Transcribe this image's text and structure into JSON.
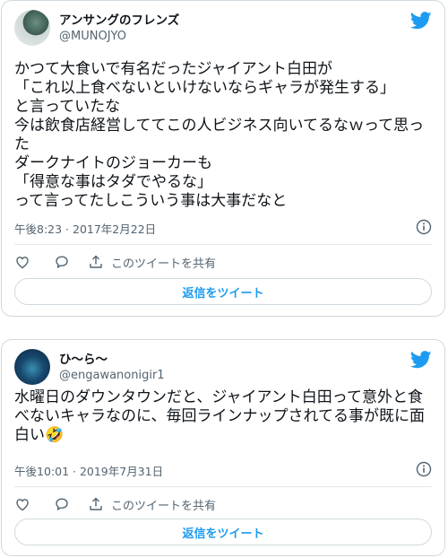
{
  "tweets": [
    {
      "display_name": "アンサングのフレンズ",
      "handle": "@MUNOJYO",
      "text": "かつて大食いで有名だったジャイアント白田が\n「これ以上食べないといけないならギャラが発生する」\nと言っていたな\n今は飲食店経営しててこの人ビジネス向いてるなｗって思った\nダークナイトのジョーカーも\n「得意な事はタダでやるな」\nって言ってたしこういう事は大事だなと",
      "timestamp": "午後8:23 · 2017年2月22日",
      "share_label": "このツイートを共有",
      "reply_button": "返信をツイート"
    },
    {
      "display_name": "ひ〜ら〜",
      "handle": "@engawanonigir1",
      "text": "水曜日のダウンタウンだと、ジャイアント白田って意外と食べないキャラなのに、毎回ラインナップされてる事が既に面白い🤣",
      "timestamp": "午後10:01 · 2019年7月31日",
      "share_label": "このツイートを共有",
      "reply_button": "返信をツイート"
    }
  ],
  "icons": {
    "brand": "twitter-bird-icon",
    "info": "info-icon",
    "like": "heart-icon",
    "reply": "speech-bubble-icon",
    "share": "share-upload-icon"
  },
  "colors": {
    "accent": "#1d9bf0",
    "text": "#0f1419",
    "secondary": "#536471",
    "border": "#cfd9de"
  }
}
